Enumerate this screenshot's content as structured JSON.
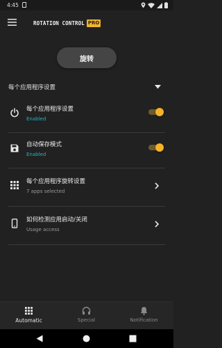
{
  "status_bar": {
    "time": "4:45",
    "icons": [
      "sd-card-icon",
      "location-icon",
      "wifi-icon",
      "signal-icon",
      "battery-icon"
    ]
  },
  "app_bar": {
    "title": "ROTATION CONTROL",
    "badge": "PRO",
    "icons": [
      "menu-icon"
    ]
  },
  "rotate_button": {
    "label": "旋转"
  },
  "section": {
    "title": "每个应用程序设置",
    "icon": "chevron-down-icon",
    "expanded": true
  },
  "settings": [
    {
      "icon": "power-icon",
      "title": "每个应用程序设置",
      "subtitle": "Enabled",
      "control": "toggle",
      "on": true
    },
    {
      "icon": "save-icon",
      "title": "自动保存模式",
      "subtitle": "Enabled",
      "control": "toggle",
      "on": true
    },
    {
      "icon": "apps-grid-icon",
      "title": "每个应用程序旋转设置",
      "subtitle": "7 apps selected",
      "control": "chevron-right-icon"
    },
    {
      "icon": "smartphone-icon",
      "title": "如何检测应用启动/关闭",
      "subtitle": "Usage access",
      "control": "chevron-right-icon"
    }
  ],
  "bottom_nav": [
    {
      "icon": "apps-grid-icon",
      "label": "Automatic",
      "active": true
    },
    {
      "icon": "headphones-icon",
      "label": "Special",
      "active": false
    },
    {
      "icon": "bell-icon",
      "label": "Notification",
      "active": false
    }
  ],
  "system_nav": [
    "back-icon",
    "home-icon",
    "recents-icon"
  ],
  "colors": {
    "background": "#212121",
    "accent": "#f4b328",
    "enabled_text": "#27b3c4",
    "button": "#454545"
  }
}
